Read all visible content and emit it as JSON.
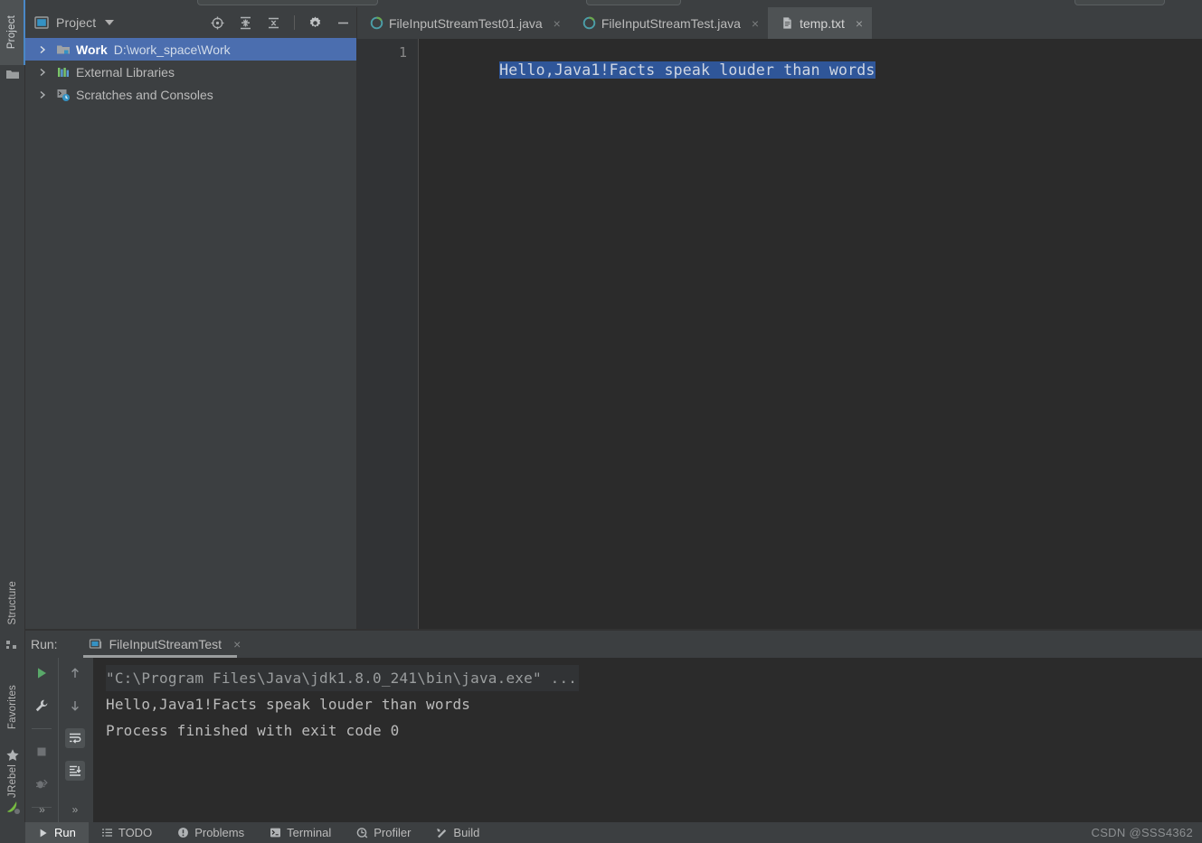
{
  "left_rail": {
    "items": [
      {
        "label": "Project",
        "icon": "project-window-icon",
        "active": true
      },
      {
        "label": "Structure",
        "icon": "structure-icon",
        "active": false
      },
      {
        "label": "Favorites",
        "icon": "star-icon",
        "active": false
      },
      {
        "label": "JRebel",
        "icon": "jrebel-icon",
        "active": false
      }
    ]
  },
  "project_panel": {
    "title": "Project",
    "dropdown_icon": "chevron-down-icon",
    "header_icon": "project-view-icon",
    "actions": [
      {
        "name": "locate-icon",
        "tooltip": "Select Opened File"
      },
      {
        "name": "expand-all-icon",
        "tooltip": "Expand All"
      },
      {
        "name": "collapse-all-icon",
        "tooltip": "Collapse All"
      },
      {
        "name": "gear-icon",
        "tooltip": "Settings"
      },
      {
        "name": "minimize-icon",
        "tooltip": "Hide"
      }
    ],
    "tree": [
      {
        "label": "Work",
        "path": "D:\\work_space\\Work",
        "icon": "module-folder-icon",
        "selected": true,
        "expander": "chevron-right-icon"
      },
      {
        "label": "External Libraries",
        "path": "",
        "icon": "libraries-icon",
        "selected": false,
        "expander": "chevron-right-icon"
      },
      {
        "label": "Scratches and Consoles",
        "path": "",
        "icon": "scratches-icon",
        "selected": false,
        "expander": "chevron-right-icon"
      }
    ]
  },
  "editor": {
    "tabs": [
      {
        "label": "FileInputStreamTest01.java",
        "icon": "java-class-icon",
        "active": false,
        "close": "×"
      },
      {
        "label": "FileInputStreamTest.java",
        "icon": "java-class-icon",
        "active": false,
        "close": "×"
      },
      {
        "label": "temp.txt",
        "icon": "text-file-icon",
        "active": true,
        "close": "×"
      }
    ],
    "line_number": "1",
    "line_text": "Hello,Java1!Facts speak louder than words"
  },
  "run_panel": {
    "label": "Run:",
    "tab": {
      "label": "FileInputStreamTest",
      "icon": "console-icon",
      "close": "×"
    },
    "toolbar_left": [
      {
        "name": "rerun-icon",
        "tooltip": "Rerun"
      },
      {
        "name": "wrench-icon",
        "tooltip": "Edit Configuration"
      },
      {
        "name": "stop-icon",
        "tooltip": "Stop"
      },
      {
        "name": "dump-threads-icon",
        "tooltip": "Dump Threads"
      },
      {
        "name": "expand-more-icon",
        "tooltip": "More"
      }
    ],
    "toolbar_right": [
      {
        "name": "arrow-up-icon",
        "tooltip": "Up the Stack Trace"
      },
      {
        "name": "arrow-down-icon",
        "tooltip": "Down the Stack Trace"
      },
      {
        "name": "soft-wrap-icon",
        "tooltip": "Soft-Wrap"
      },
      {
        "name": "scroll-to-end-icon",
        "tooltip": "Scroll to End"
      },
      {
        "name": "expand-more-icon",
        "tooltip": "More"
      }
    ],
    "console_lines": [
      {
        "text": "\"C:\\Program Files\\Java\\jdk1.8.0_241\\bin\\java.exe\" ...",
        "style": "command"
      },
      {
        "text": "Hello,Java1!Facts speak louder than words",
        "style": "output"
      },
      {
        "text": "Process finished with exit code 0",
        "style": "output"
      }
    ]
  },
  "status_bar": {
    "items": [
      {
        "label": "Run",
        "icon": "play-icon",
        "active": true
      },
      {
        "label": "TODO",
        "icon": "todo-icon",
        "active": false
      },
      {
        "label": "Problems",
        "icon": "problems-icon",
        "active": false
      },
      {
        "label": "Terminal",
        "icon": "terminal-icon",
        "active": false
      },
      {
        "label": "Profiler",
        "icon": "profiler-icon",
        "active": false
      },
      {
        "label": "Build",
        "icon": "build-icon",
        "active": false
      }
    ],
    "watermark": "CSDN @SSS4362"
  },
  "colors": {
    "panel_bg": "#3c3f41",
    "editor_bg": "#2b2b2b",
    "gutter_bg": "#313335",
    "selection_blue": "#2f5699",
    "tree_selection": "#4b6eaf",
    "accent": "#4a88c7",
    "text": "#bbbbbb",
    "code_text": "#a9b7c6",
    "green_run": "#59a869"
  }
}
